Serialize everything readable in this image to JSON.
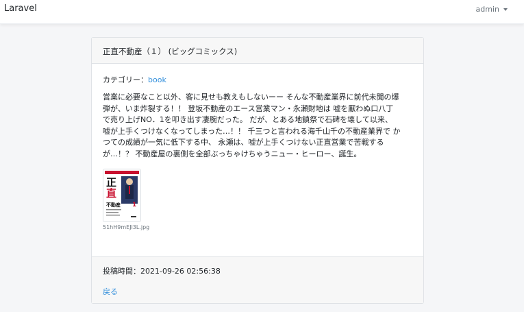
{
  "navbar": {
    "brand": "Laravel",
    "user": "admin"
  },
  "book": {
    "title": "正直不動産（１） (ビッグコミックス)",
    "category_label": "カテゴリー：",
    "category_link": "book",
    "description": "営業に必要なこと以外、客に見せも教えもしないーー そんな不動産業界に前代未聞の爆\n弾が、いま炸裂する！！ 登坂不動産のエース営業マン・永瀬財地は 嘘を厭わぬ口八丁\nで売り上げNO．1を叩き出す凄腕だった。 だが、とある地鎮祭で石碑を壊して以来、\n嘘が上手くつけなくなってしまった…！！ 千三つと言われる海千山千の不動産業界で か\nつての成績が一気に低下する中、 永瀬は、嘘が上手くつけない正直営業で苦戦する\nが…！？ 不動産屋の裏側を全部ぶっちゃけちゃうニュー・ヒーロー、誕生。",
    "image_filename": "51hH9mEJl3L.jpg",
    "cover": {
      "title_chars": "正直",
      "subtitle_chars": "不動産",
      "volume": "1"
    },
    "posted_label": "投稿時間：",
    "posted_at": "2021-09-26 02:56:38",
    "back_label": "戻る"
  }
}
